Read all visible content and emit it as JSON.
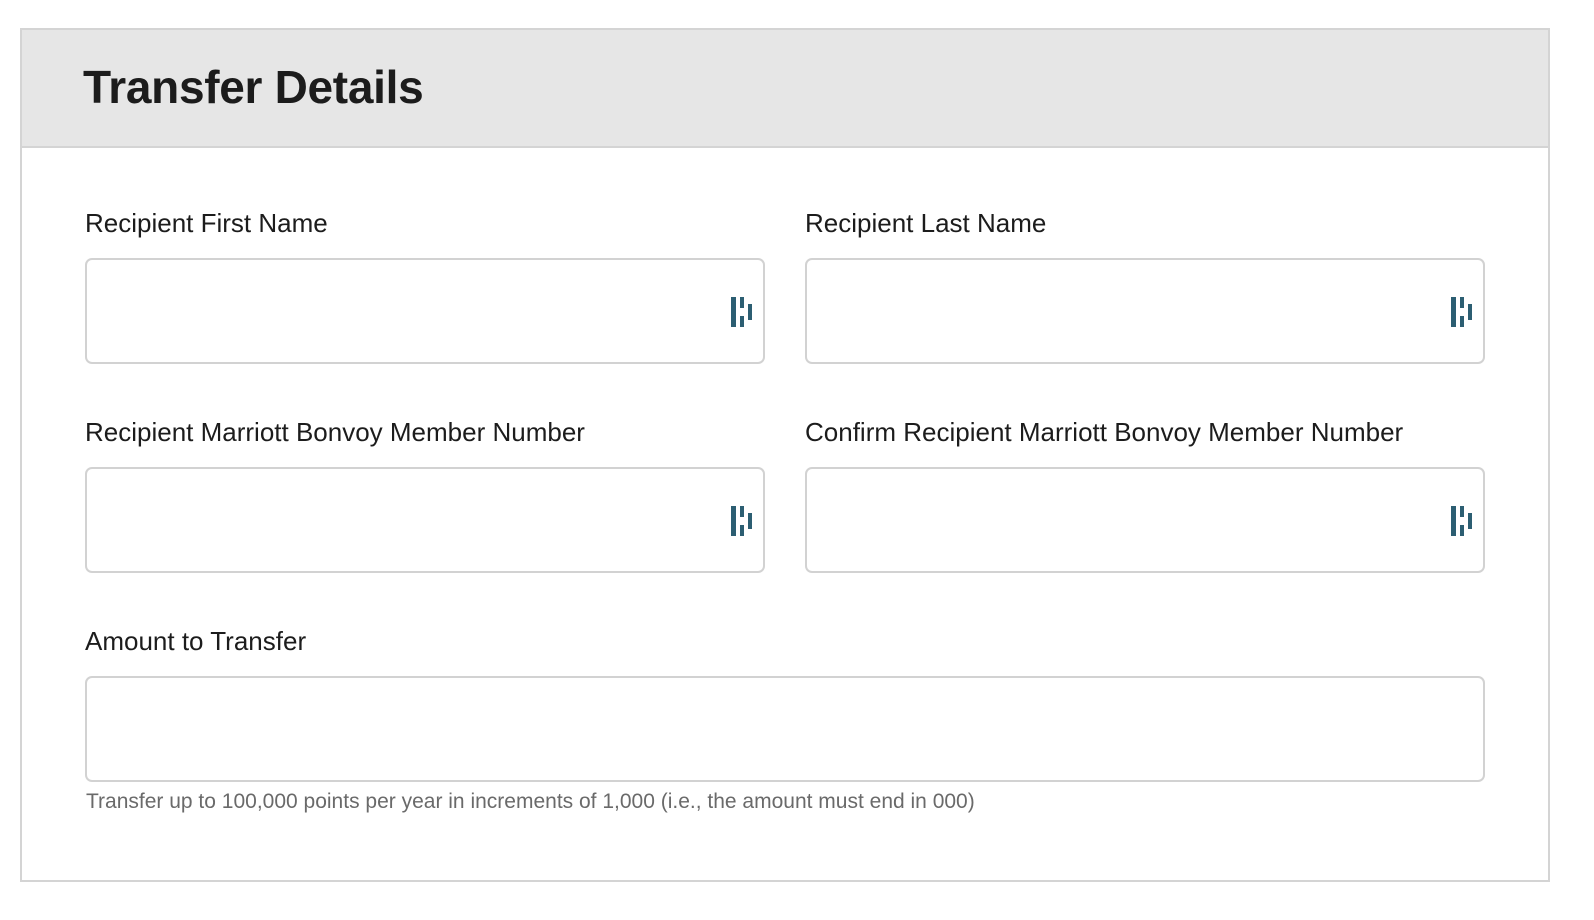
{
  "section": {
    "title": "Transfer Details"
  },
  "fields": {
    "first_name": {
      "label": "Recipient First Name",
      "value": ""
    },
    "last_name": {
      "label": "Recipient Last Name",
      "value": ""
    },
    "member_number": {
      "label": "Recipient Marriott Bonvoy Member Number",
      "value": ""
    },
    "confirm_member_number": {
      "label": "Confirm Recipient Marriott Bonvoy Member Number",
      "value": ""
    },
    "amount": {
      "label": "Amount to Transfer",
      "value": "",
      "hint": "Transfer up to 100,000 points per year in increments of 1,000 (i.e., the amount must end in 000)"
    }
  },
  "icons": {
    "autofill": "password-manager-icon"
  },
  "colors": {
    "header_bg": "#e6e6e6",
    "border": "#d2d2d2",
    "icon": "#2c5e72",
    "text": "#1c1c1c",
    "hint_text": "#6a6a6a"
  }
}
